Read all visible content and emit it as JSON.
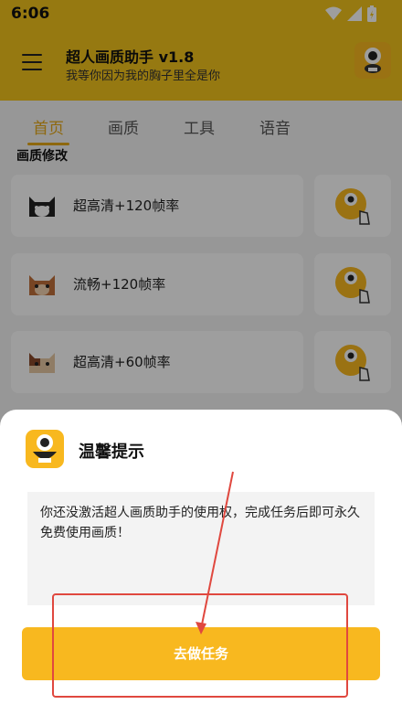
{
  "status_bar": {
    "time": "6:06"
  },
  "app_bar": {
    "title": "超人画质助手 v1.8",
    "subtitle": "我等你因为我的胸子里全是你"
  },
  "tabs": [
    {
      "label": "首页",
      "active": true
    },
    {
      "label": "画质",
      "active": false
    },
    {
      "label": "工具",
      "active": false
    },
    {
      "label": "语音",
      "active": false
    }
  ],
  "section_title": "画质修改",
  "options": [
    {
      "label": "超高清+120帧率",
      "icon": "cat-black-white-icon"
    },
    {
      "label": "流畅+120帧率",
      "icon": "cat-orange-icon"
    },
    {
      "label": "超高清+60帧率",
      "icon": "cat-calico-icon"
    }
  ],
  "dialog": {
    "title": "温馨提示",
    "message": "你还没激活超人画质助手的使用权，完成任务后即可永久免费使用画质！",
    "button_label": "去做任务"
  },
  "colors": {
    "brand_yellow": "#f2c31c",
    "button_yellow": "#f8b81f",
    "annotation_red": "#e0483f"
  }
}
